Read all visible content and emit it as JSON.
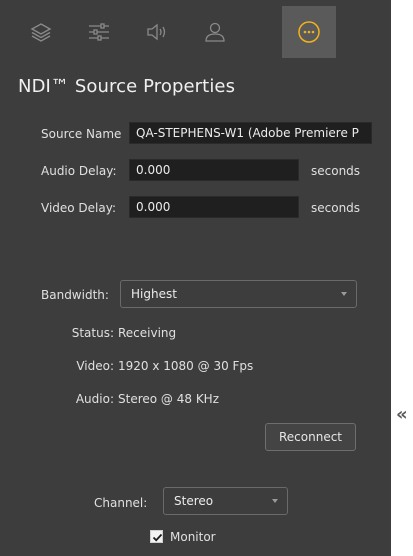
{
  "toolbar": {
    "tabs": [
      {
        "name": "layers-icon"
      },
      {
        "name": "sliders-icon"
      },
      {
        "name": "speaker-icon"
      },
      {
        "name": "user-icon"
      },
      {
        "name": "more-icon",
        "active": true
      }
    ],
    "accent_color": "#f2b21b"
  },
  "panel": {
    "title": "NDI™ Source Properties",
    "source_name_label": "Source Name",
    "source_name_value": "QA-STEPHENS-W1 (Adobe Premiere P",
    "audio_delay_label": "Audio Delay:",
    "audio_delay_value": "0.000",
    "audio_delay_unit": "seconds",
    "video_delay_label": "Video Delay:",
    "video_delay_value": "0.000",
    "video_delay_unit": "seconds",
    "bandwidth_label": "Bandwidth:",
    "bandwidth_value": "Highest",
    "status_label": "Status:",
    "status_value": "Receiving",
    "video_label": "Video:",
    "video_value": "1920 x 1080 @ 30 Fps",
    "audio_label": "Audio:",
    "audio_value": "Stereo @ 48 KHz",
    "reconnect_label": "Reconnect",
    "channel_label": "Channel:",
    "channel_value": "Stereo",
    "monitor_label": "Monitor",
    "monitor_checked": true
  },
  "collapse_glyph": "«"
}
